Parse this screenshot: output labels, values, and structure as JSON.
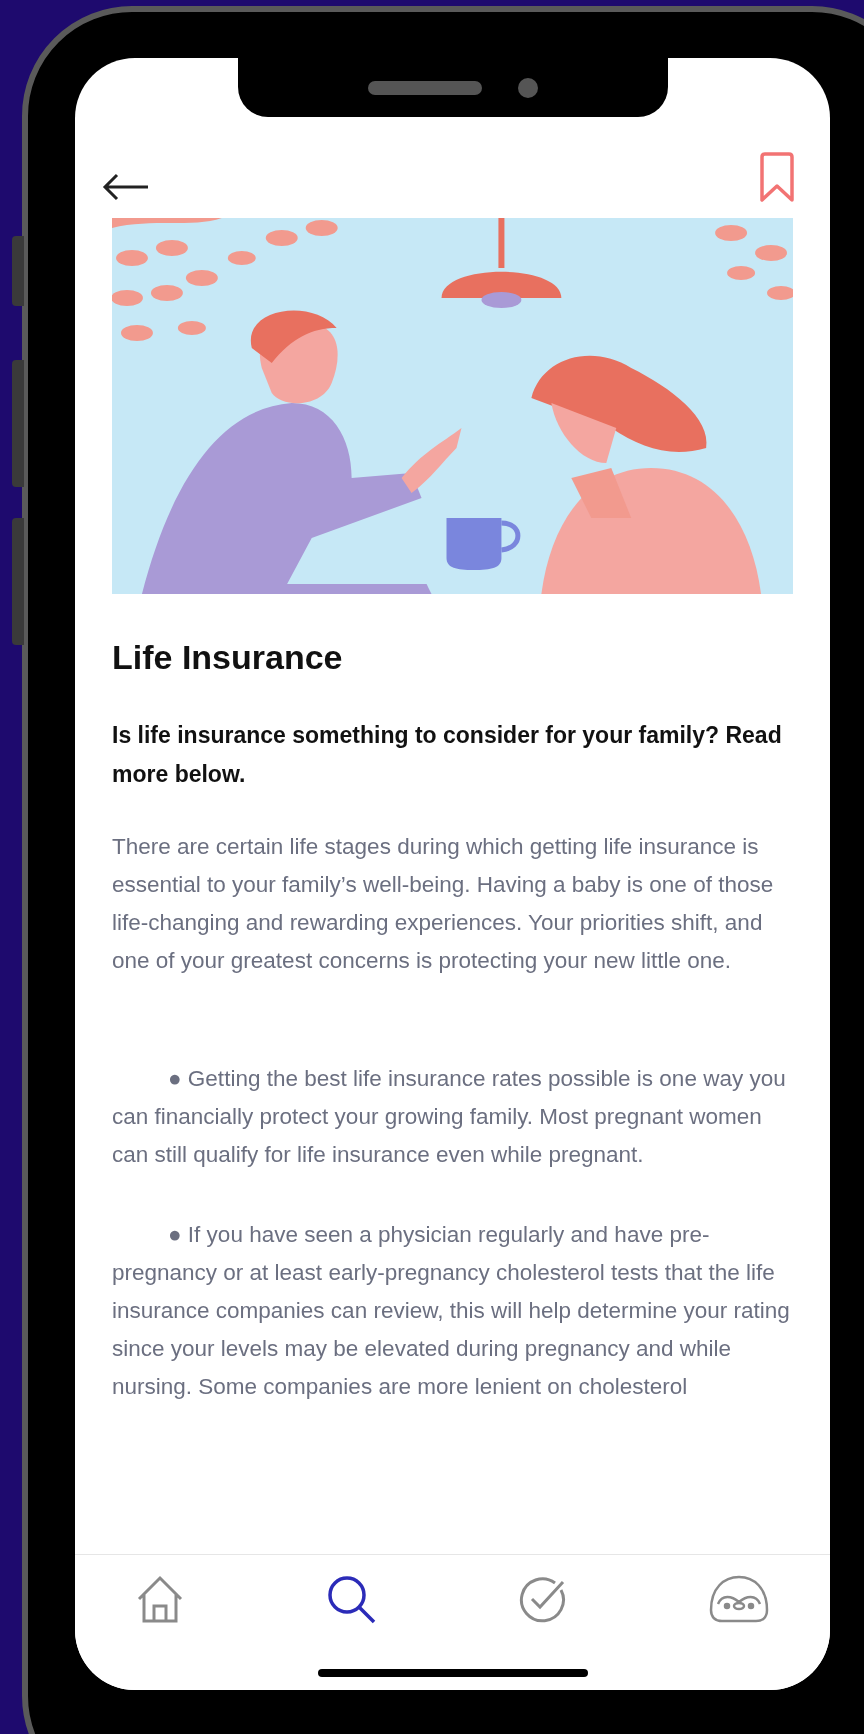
{
  "article": {
    "title": "Life Insurance",
    "subtitle": "Is life insurance something to consider for your family? Read more below.",
    "paragraphs": [
      {
        "kind": "text",
        "text": "There are certain life stages during which getting life insurance is essential to your family’s well-being. Having a baby is one of those life-changing and rewarding experiences. Your priorities shift, and one of your greatest concerns is protecting your new little one."
      },
      {
        "kind": "bullet",
        "bullet": "●",
        "text": "Getting the best life insurance rates possible is one way you can financially protect your growing family. Most pregnant women can still qualify for life insurance even while pregnant."
      },
      {
        "kind": "bullet",
        "bullet": "●",
        "text": "If you have seen a physician regularly and have pre-pregnancy or at least early-pregnancy cholesterol tests that the life insurance companies can review, this will help determine your rating since your levels may be elevated during pregnancy and while nursing. Some companies are more lenient on cholesterol"
      }
    ]
  },
  "tab_bar": [
    {
      "selected": false
    },
    {
      "selected": true
    },
    {
      "selected": false
    },
    {
      "selected": false
    }
  ]
}
